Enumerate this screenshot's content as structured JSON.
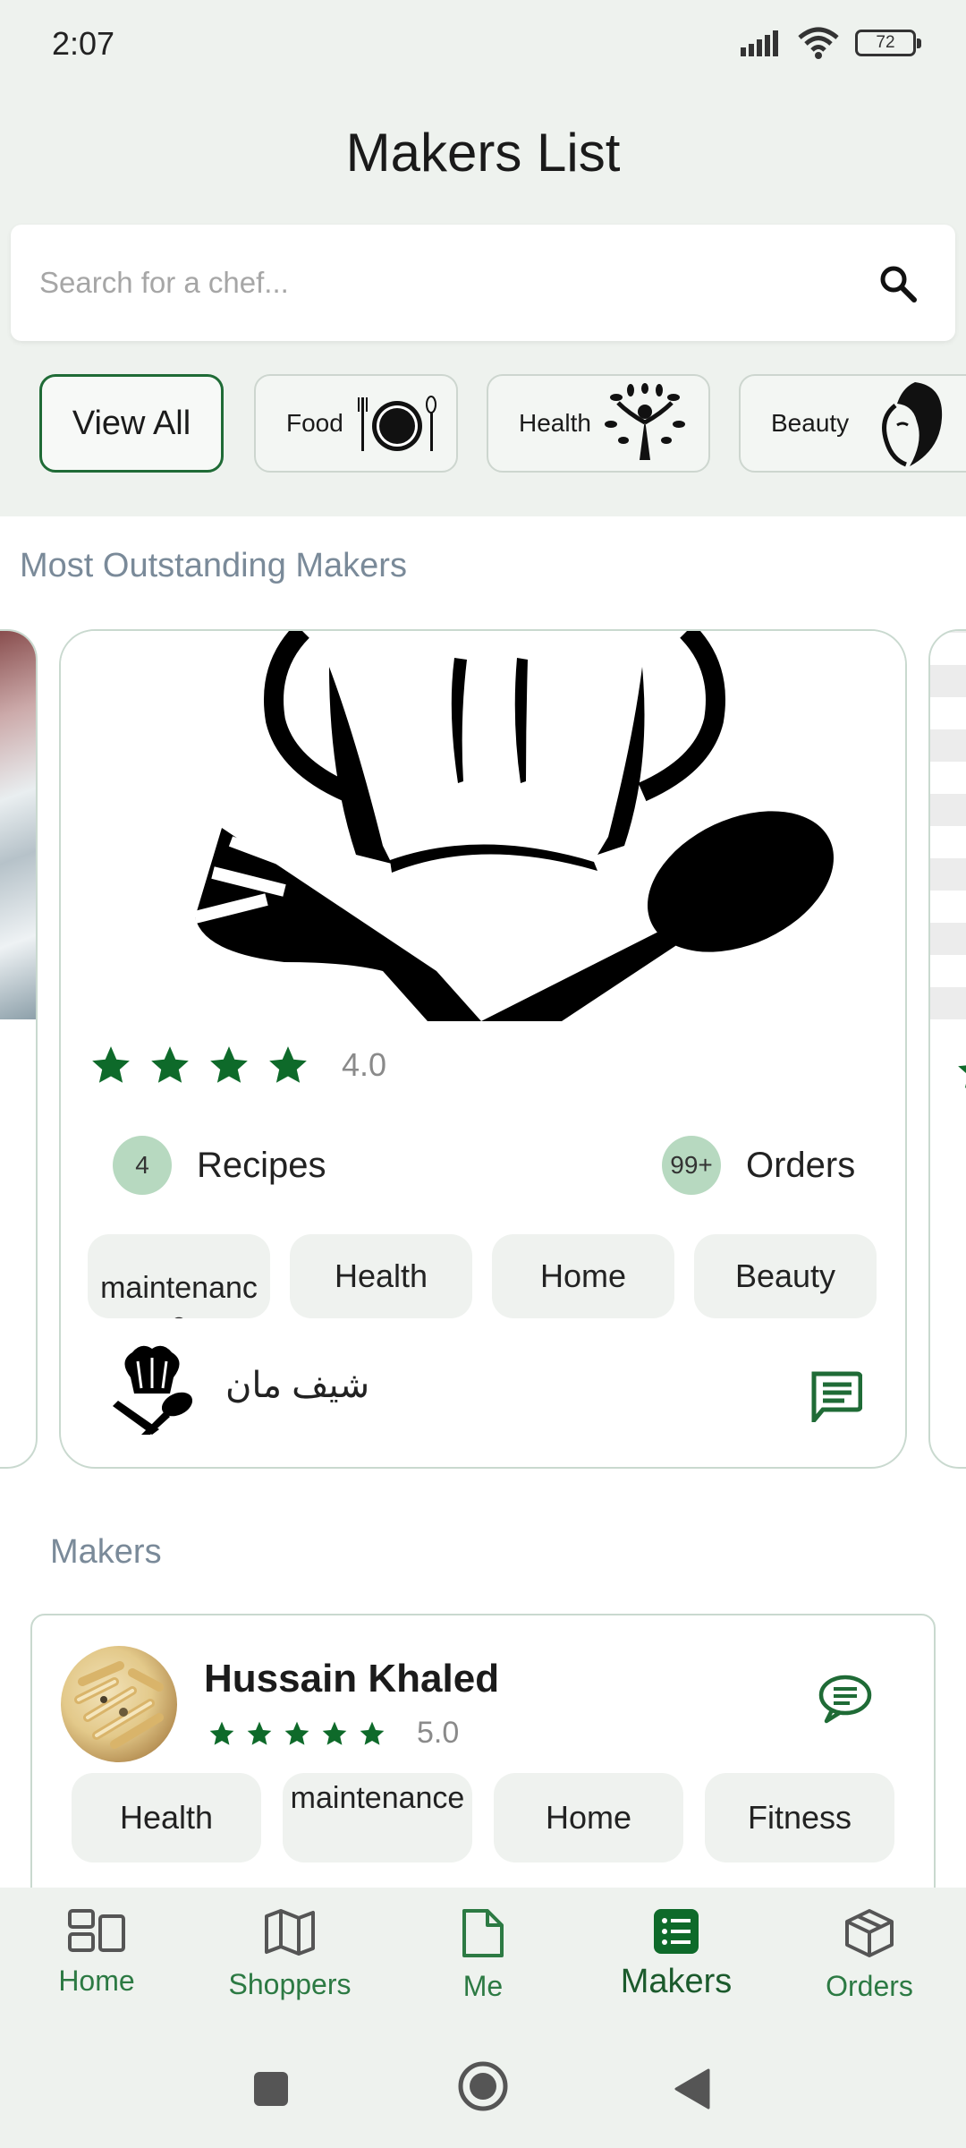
{
  "status": {
    "time": "2:07",
    "battery": "72"
  },
  "header": {
    "title": "Makers List"
  },
  "search": {
    "placeholder": "Search for a chef..."
  },
  "categories": [
    {
      "label": "View All",
      "icon": "none",
      "active": true
    },
    {
      "label": "Food",
      "icon": "plate-cutlery-icon"
    },
    {
      "label": "Health",
      "icon": "tree-person-icon"
    },
    {
      "label": "Beauty",
      "icon": "woman-face-icon"
    }
  ],
  "featured": {
    "section_title": "Most Outstanding Makers",
    "card": {
      "rating": "4.0",
      "recipes_count": "4",
      "recipes_label": "Recipes",
      "orders_count": "99+",
      "orders_label": "Orders",
      "tags": [
        "maintenance",
        "Health",
        "Home",
        "Beauty"
      ],
      "maker_name": "شيف مان"
    }
  },
  "makers": {
    "section_title": "Makers",
    "list": [
      {
        "name": "Hussain Khaled",
        "rating": "5.0",
        "tags": [
          "Health",
          "maintenance",
          "Home",
          "Fitness"
        ]
      }
    ]
  },
  "nav": {
    "items": [
      {
        "label": "Home",
        "icon": "dashboard-icon"
      },
      {
        "label": "Shoppers",
        "icon": "map-icon"
      },
      {
        "label": "Me",
        "icon": "document-icon"
      },
      {
        "label": "Makers",
        "icon": "list-icon",
        "active": true
      },
      {
        "label": "Orders",
        "icon": "box-icon"
      }
    ]
  },
  "colors": {
    "accent": "#1f6b36",
    "star": "#0e6a2a",
    "badge": "#b7d9c0"
  }
}
